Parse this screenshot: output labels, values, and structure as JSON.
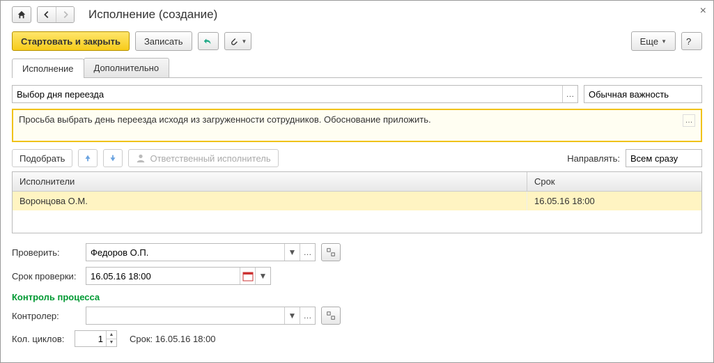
{
  "title": "Исполнение (создание)",
  "toolbar": {
    "start_close": "Стартовать и закрыть",
    "save": "Записать",
    "more": "Еще"
  },
  "tabs": {
    "execution": "Исполнение",
    "additional": "Дополнительно"
  },
  "subject": {
    "value": "Выбор дня переезда"
  },
  "importance": {
    "value": "Обычная важность"
  },
  "description": "Просьба выбрать день переезда исходя из загруженности сотрудников. Обоснование приложить.",
  "performers_bar": {
    "pick": "Подобрать",
    "responsible": "Ответственный исполнитель",
    "route_label": "Направлять:",
    "route_value": "Всем сразу"
  },
  "table": {
    "col_performers": "Исполнители",
    "col_deadline": "Срок",
    "row1_name": "Воронцова О.М.",
    "row1_deadline": "16.05.16 18:00"
  },
  "check": {
    "label": "Проверить:",
    "value": "Федоров О.П.",
    "deadline_label": "Срок проверки:",
    "deadline_value": "16.05.16 18:00"
  },
  "control": {
    "section": "Контроль процесса",
    "controller_label": "Контролер:",
    "controller_value": "",
    "cycles_label": "Кол. циклов:",
    "cycles_value": "1",
    "deadline_label": "Срок:",
    "deadline_value": "16.05.16 18:00"
  }
}
